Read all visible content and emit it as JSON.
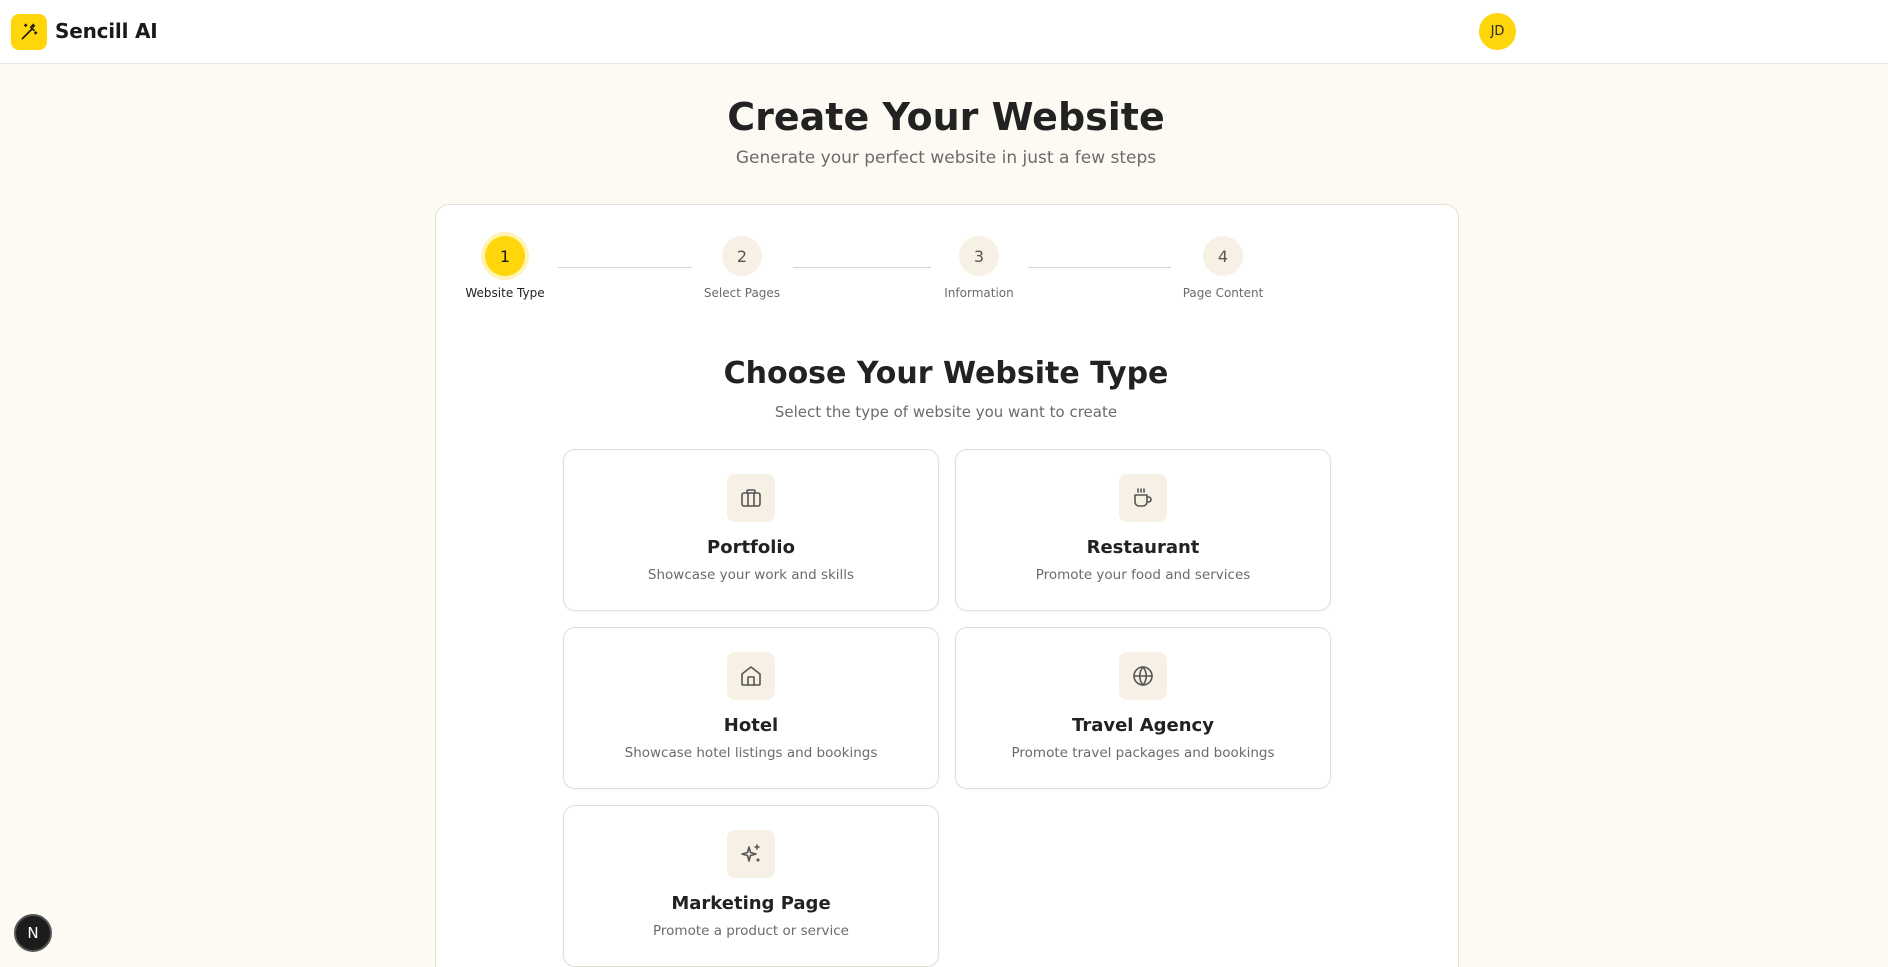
{
  "header": {
    "brand": "Sencill AI",
    "logo_icon": "magic-wand-icon",
    "avatar_initials": "JD"
  },
  "hero": {
    "title": "Create Your Website",
    "subtitle": "Generate your perfect website in just a few steps"
  },
  "stepper": {
    "steps": [
      {
        "number": "1",
        "label": "Website Type",
        "active": true
      },
      {
        "number": "2",
        "label": "Select Pages",
        "active": false
      },
      {
        "number": "3",
        "label": "Information",
        "active": false
      },
      {
        "number": "4",
        "label": "Page Content",
        "active": false
      }
    ]
  },
  "section": {
    "title": "Choose Your Website Type",
    "subtitle": "Select the type of website you want to create"
  },
  "website_types": [
    {
      "title": "Portfolio",
      "description": "Showcase your work and skills",
      "icon": "briefcase-icon"
    },
    {
      "title": "Restaurant",
      "description": "Promote your food and services",
      "icon": "coffee-cup-icon"
    },
    {
      "title": "Hotel",
      "description": "Showcase hotel listings and bookings",
      "icon": "home-icon"
    },
    {
      "title": "Travel Agency",
      "description": "Promote travel packages and bookings",
      "icon": "globe-icon"
    },
    {
      "title": "Marketing Page",
      "description": "Promote a product or service",
      "icon": "sparkles-icon"
    }
  ],
  "dev_badge": {
    "label": "N",
    "icon": "nextjs-icon"
  },
  "colors": {
    "accent": "#ffd60a",
    "background": "#fdfaf3",
    "icon_tile": "#f6f1e4"
  }
}
